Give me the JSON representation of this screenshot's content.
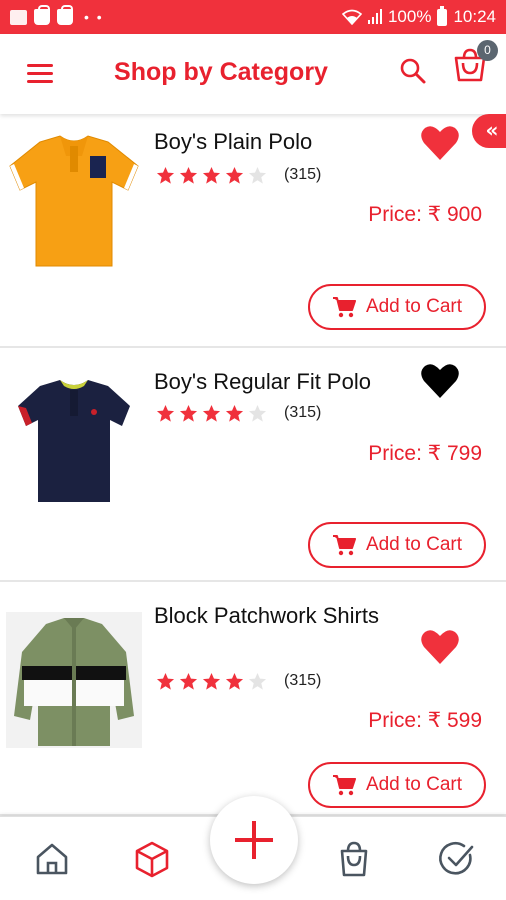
{
  "status_bar": {
    "battery": "100%",
    "time": "10:24"
  },
  "header": {
    "title": "Shop by Category",
    "cart_count": "0"
  },
  "products": [
    {
      "name": "Boy's Plain Polo",
      "rating": 4,
      "reviews": "(315)",
      "price_label": "Price:",
      "price": "₹ 900",
      "favorite_color": "#f0313c",
      "add_label": "Add to Cart"
    },
    {
      "name": "Boy's Regular Fit Polo",
      "rating": 4,
      "reviews": "(315)",
      "price_label": "Price:",
      "price": "₹ 799",
      "favorite_color": "#000000",
      "add_label": "Add to Cart"
    },
    {
      "name": "Block Patchwork Shirts",
      "rating": 4,
      "reviews": "(315)",
      "price_label": "Price:",
      "price": "₹ 599",
      "favorite_color": "#f0313c",
      "add_label": "Add to Cart"
    }
  ],
  "bottom_nav": [
    "home-icon",
    "box-icon",
    "plus-icon",
    "shopping-bag-icon",
    "check-circle-icon"
  ],
  "colors": {
    "accent": "#e8212e",
    "status_bar": "#f0313c"
  }
}
